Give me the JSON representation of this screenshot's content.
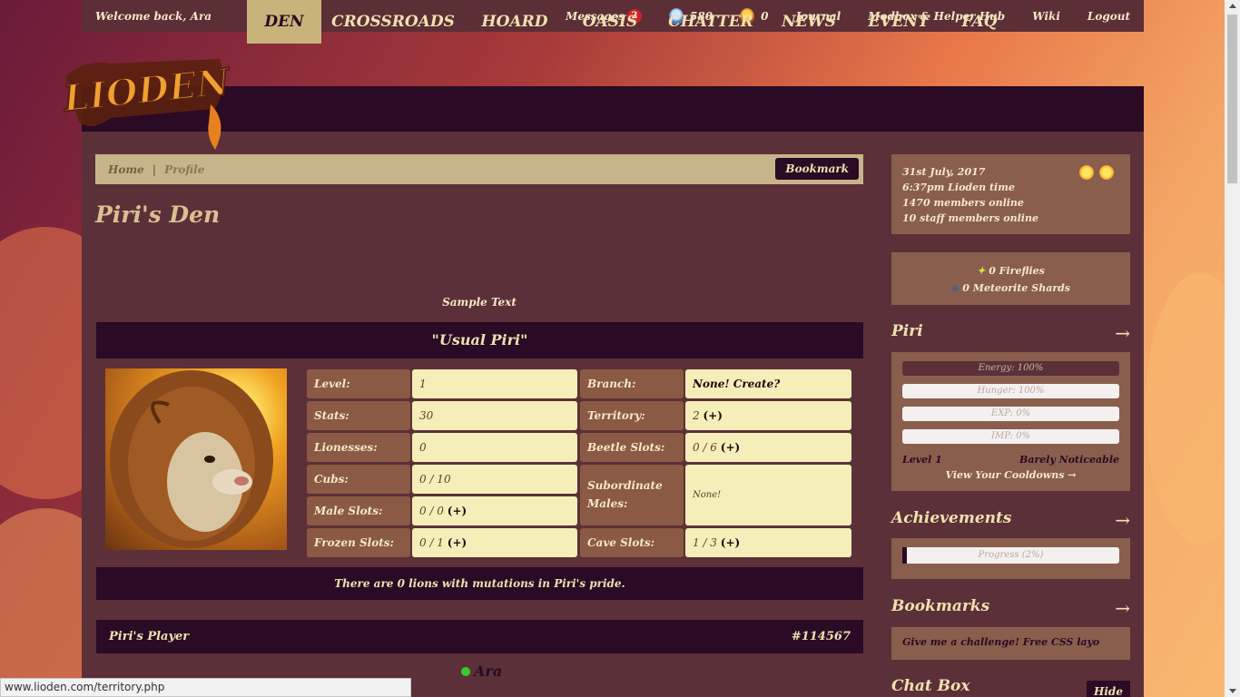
{
  "topbar": {
    "welcome": "Welcome back, Ara",
    "messages_label": "Messages",
    "messages_count": "2",
    "gold_beetles": "580",
    "silver_beetles": "0",
    "journal": "Journal",
    "modbox": "Modbox & Helper Hub",
    "wiki": "Wiki",
    "logout": "Logout"
  },
  "logo": {
    "text": "LIODEN"
  },
  "nav": [
    "DEN",
    "CROSSROADS",
    "HOARD",
    "OASIS",
    "CHATTER",
    "NEWS",
    "EVENT",
    "FAQ"
  ],
  "breadcrumb": {
    "home": "Home",
    "separator": "|",
    "current": "Profile",
    "bookmark": "Bookmark"
  },
  "page": {
    "title": "Piri's Den",
    "sample_text": "Sample Text",
    "lion_name": "\"Usual Piri\"",
    "stats_left": [
      {
        "label": "Level:",
        "value": "1"
      },
      {
        "label": "Stats:",
        "value": "30"
      },
      {
        "label": "Lionesses:",
        "value": "0"
      },
      {
        "label": "Cubs:",
        "value": "0 / 10"
      },
      {
        "label": "Male Slots:",
        "value": "0 / 0",
        "plus": "(+)"
      },
      {
        "label": "Frozen Slots:",
        "value": "0 / 1",
        "plus": "(+)"
      }
    ],
    "stats_right": [
      {
        "label": "Branch:",
        "value": "None! Create?"
      },
      {
        "label": "Territory:",
        "value": "2",
        "plus": "(+)"
      },
      {
        "label": "Beetle Slots:",
        "value": "0 / 6",
        "plus": "(+)"
      },
      {
        "label": "Subordinate Males:",
        "value": "None!"
      },
      {
        "label": "Cave Slots:",
        "value": "1 / 3",
        "plus": "(+)"
      }
    ],
    "mutations": "There are 0 lions with mutations in Piri's pride.",
    "player_header": "Piri's Player",
    "player_id": "#114567",
    "player_name": "Ara"
  },
  "sidebar": {
    "date": "31st July, 2017",
    "time": "6:37pm Lioden time",
    "members_online": "1470 members online",
    "staff_online": "10 staff members online",
    "fireflies": "0 Fireflies",
    "shards": "0 Meteorite Shards",
    "lion_section": "Piri",
    "arrow": "→",
    "bars": [
      {
        "label": "Energy: 100%",
        "value": 100
      },
      {
        "label": "Hunger: 100%",
        "value": 100
      },
      {
        "label": "EXP: 0%",
        "value": 0
      },
      {
        "label": "IMP: 0%",
        "value": 0
      }
    ],
    "level": "Level 1",
    "noticeability": "Barely Noticeable",
    "cooldowns": "View Your Cooldowns →",
    "achievements": "Achievements",
    "progress": "Progress (2%)",
    "progress_value": 2,
    "bookmarks": "Bookmarks",
    "bookmark_item": "Give me a challenge! Free CSS layo",
    "chatbox": "Chat Box",
    "hide": "Hide"
  },
  "statusbar": "www.lioden.com/territory.php",
  "colors": {
    "dark": "#2a0a24",
    "panel": "#5c3038",
    "accent": "#c8b47a",
    "value_bg": "#f5eeb8"
  }
}
